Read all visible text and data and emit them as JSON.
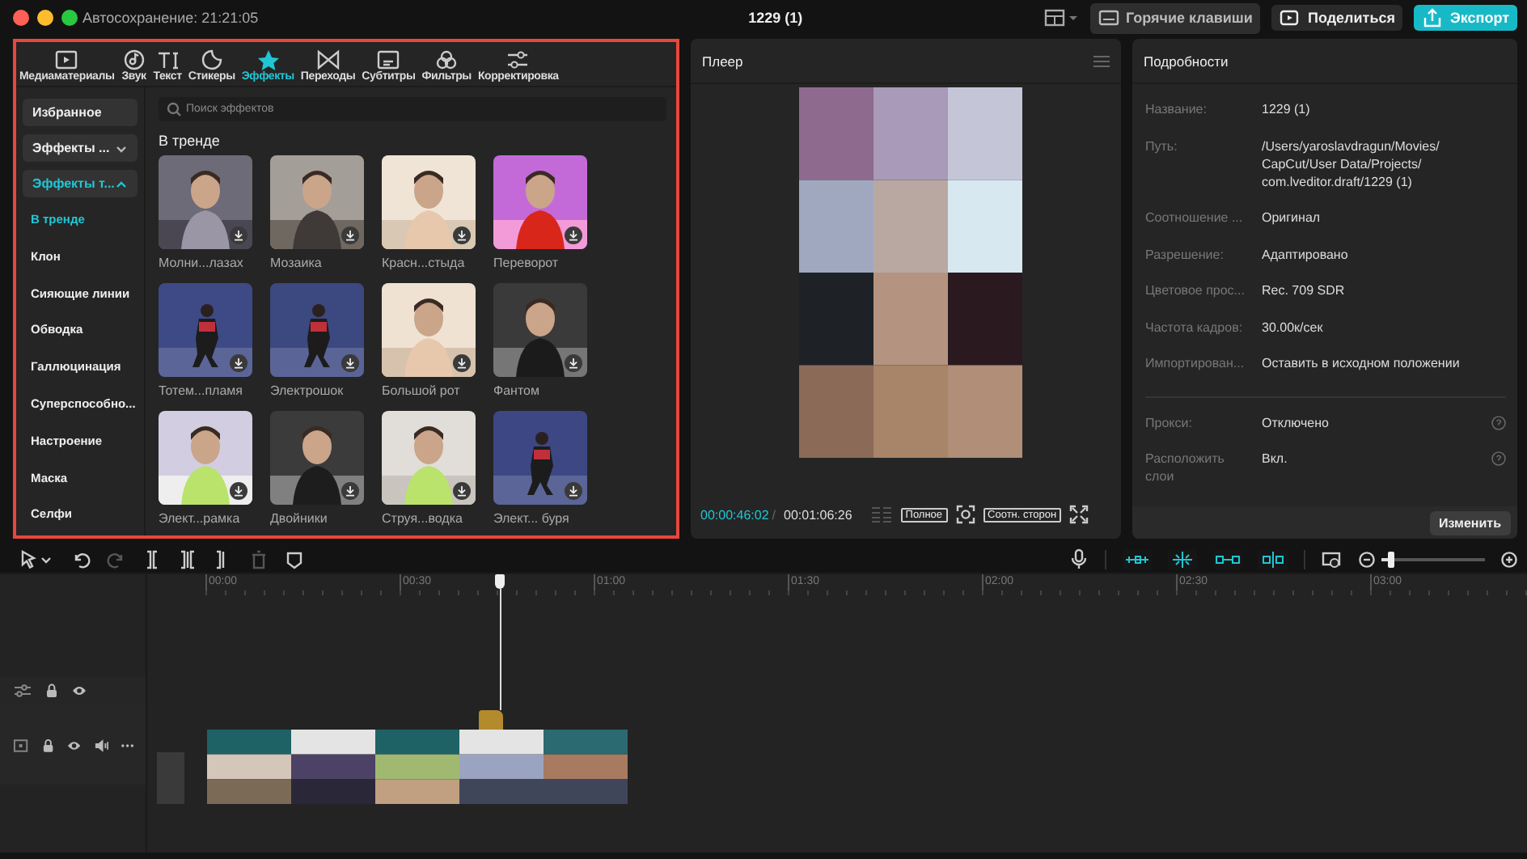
{
  "window": {
    "autosave": "Автосохранение: 21:21:05",
    "title": "1229 (1)"
  },
  "header_buttons": [
    {
      "kind": "plain",
      "label": "Горячие клавиши"
    },
    {
      "kind": "share",
      "label": "Поделиться"
    },
    {
      "kind": "primary",
      "label": "Экспорт"
    }
  ],
  "tabs": [
    {
      "label": "Медиаматериалы",
      "selected": false
    },
    {
      "label": "Звук",
      "selected": false
    },
    {
      "label": "Текст",
      "selected": false
    },
    {
      "label": "Стикеры",
      "selected": false
    },
    {
      "label": "Эффекты",
      "selected": true
    },
    {
      "label": "Переходы",
      "selected": false
    },
    {
      "label": "Субтитры",
      "selected": false
    },
    {
      "label": "Фильтры",
      "selected": false
    },
    {
      "label": "Корректировка",
      "selected": false
    }
  ],
  "sidebar": [
    {
      "kind": "item",
      "label": "Избранное"
    },
    {
      "kind": "group",
      "label": "Эффекты ...",
      "expanded": false
    },
    {
      "kind": "group",
      "label": "Эффекты т...",
      "expanded": true,
      "children": [
        {
          "label": "В тренде",
          "selected": true
        },
        {
          "label": "Клон",
          "selected": false
        },
        {
          "label": "Сияющие линии",
          "selected": false
        },
        {
          "label": "Обводка",
          "selected": false
        },
        {
          "label": "Галлюцинация",
          "selected": false
        },
        {
          "label": "Суперспособно...",
          "selected": false
        },
        {
          "label": "Настроение",
          "selected": false
        },
        {
          "label": "Маска",
          "selected": false
        },
        {
          "label": "Селфи",
          "selected": false
        }
      ]
    }
  ],
  "search": {
    "placeholder": "Поиск эффектов"
  },
  "section_title": "В тренде",
  "effects": [
    {
      "label": "Молни...лазах"
    },
    {
      "label": "Мозаика"
    },
    {
      "label": "Красн...стыда"
    },
    {
      "label": "Переворот"
    },
    {
      "label": "Тотем...пламя"
    },
    {
      "label": "Электрошок"
    },
    {
      "label": "Большой рот"
    },
    {
      "label": "Фантом"
    },
    {
      "label": "Элект...рамка"
    },
    {
      "label": "Двойники"
    },
    {
      "label": "Струя...водка"
    },
    {
      "label": "Элект... буря"
    }
  ],
  "player": {
    "title": "Плеер",
    "current_time": "00:00:46:02",
    "separator": "/",
    "duration": "00:01:06:26",
    "quality": "Полное",
    "ratio": "Соотн. сторон"
  },
  "details": {
    "title": "Подробности",
    "rows": [
      {
        "label": "Название:",
        "value": "1229 (1)"
      },
      {
        "label": "Путь:",
        "value": "/Users/yaroslavdragun/Movies/ CapCut/User Data/Projects/ com.lveditor.draft/1229 (1)"
      },
      {
        "label": "Соотношение ...",
        "value": "Оригинал"
      },
      {
        "label": "Разрешение:",
        "value": "Адаптировано"
      },
      {
        "label": "Цветовое прос...",
        "value": "Rec. 709 SDR"
      },
      {
        "label": "Частота кадров:",
        "value": "30.00к/сек"
      },
      {
        "label": "Импортирован...",
        "value": "Оставить в исходном положении"
      }
    ],
    "extra_rows": [
      {
        "label": "Прокси:",
        "value": "Отключено"
      },
      {
        "label": "Расположить слои",
        "value": "Вкл."
      }
    ],
    "button": "Изменить"
  },
  "timeline": {
    "toggles": [
      {
        "on": true
      },
      {
        "on": true
      },
      {
        "on": true
      },
      {
        "on": true
      }
    ],
    "zoom": {
      "level": 0.1
    },
    "ruler": [
      "00:00",
      "00:30",
      "01:00",
      "01:30",
      "02:00",
      "02:30",
      "03:00"
    ]
  }
}
